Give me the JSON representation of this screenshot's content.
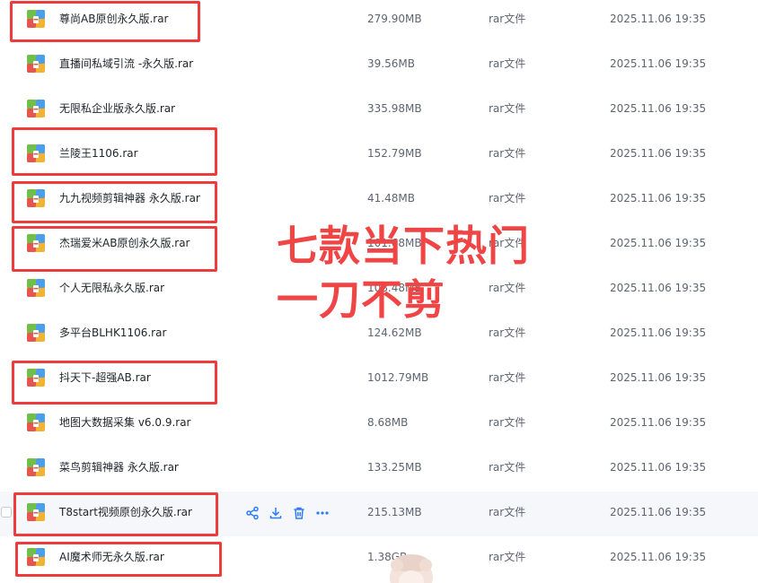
{
  "files": [
    {
      "name": "尊尚AB原创永久版.rar",
      "size": "279.90MB",
      "type": "rar文件",
      "date": "2025.11.06 19:35"
    },
    {
      "name": "直播间私域引流 -永久版.rar",
      "size": "39.56MB",
      "type": "rar文件",
      "date": "2025.11.06 19:35"
    },
    {
      "name": "无限私企业版永久版.rar",
      "size": "335.98MB",
      "type": "rar文件",
      "date": "2025.11.06 19:35"
    },
    {
      "name": "兰陵王1106.rar",
      "size": "152.79MB",
      "type": "rar文件",
      "date": "2025.11.06 19:35"
    },
    {
      "name": "九九视频剪辑神器 永久版.rar",
      "size": "41.48MB",
      "type": "rar文件",
      "date": "2025.11.06 19:35"
    },
    {
      "name": "杰瑞爱米AB原创永久版.rar",
      "size": "101.68MB",
      "type": "rar文件",
      "date": "2025.11.06 19:35"
    },
    {
      "name": "个人无限私永久版.rar",
      "size": "108.48MB",
      "type": "rar文件",
      "date": "2025.11.06 19:35"
    },
    {
      "name": "多平台BLHK1106.rar",
      "size": "124.62MB",
      "type": "rar文件",
      "date": "2025.11.06 19:35"
    },
    {
      "name": "抖天下-超强AB.rar",
      "size": "1012.79MB",
      "type": "rar文件",
      "date": "2025.11.06 19:35"
    },
    {
      "name": "地图大数据采集 v6.0.9.rar",
      "size": "8.68MB",
      "type": "rar文件",
      "date": "2025.11.06 19:35"
    },
    {
      "name": "菜鸟剪辑神器 永久版.rar",
      "size": "133.25MB",
      "type": "rar文件",
      "date": "2025.11.06 19:35"
    },
    {
      "name": "T8start视频原创永久版.rar",
      "size": "215.13MB",
      "type": "rar文件",
      "date": "2025.11.06 19:35"
    },
    {
      "name": "AI魔术师无永久版.rar",
      "size": "1.38GB",
      "type": "rar文件",
      "date": "2025.11.06 19:35"
    }
  ],
  "hovered_row": 11,
  "highlighted_rows": [
    0,
    3,
    4,
    5,
    8,
    11,
    12
  ],
  "row_actions": [
    "share-icon",
    "download-icon",
    "delete-icon",
    "more-icon"
  ],
  "overlay": {
    "line1": "七款当下热门",
    "line2": "一刀不剪"
  },
  "colors": {
    "highlight": "#ee3b3b",
    "overlay_text": "#f04545",
    "action_icon": "#2f7cf6",
    "hover_row": "#f5f7fa"
  },
  "icons": {
    "file": "rar-archive-icon"
  }
}
